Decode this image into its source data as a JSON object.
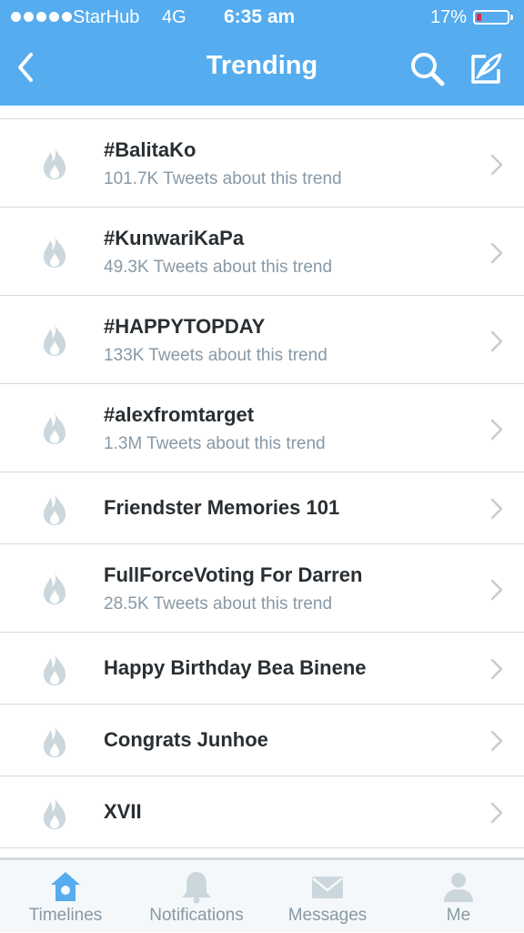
{
  "status_bar": {
    "carrier": "StarHub",
    "network": "4G",
    "time": "6:35 am",
    "battery_percent": "17%",
    "battery_level": 0.17,
    "battery_color": "#e8283a"
  },
  "nav": {
    "title": "Trending",
    "back_icon": "chevron-left-icon",
    "search_icon": "search-icon",
    "compose_icon": "compose-tweet-icon"
  },
  "trends": [
    {
      "name": "#BalitaKo",
      "subtitle": "101.7K Tweets about this trend"
    },
    {
      "name": "#KunwariKaPa",
      "subtitle": "49.3K Tweets about this trend"
    },
    {
      "name": "#HAPPYTOPDAY",
      "subtitle": "133K Tweets about this trend"
    },
    {
      "name": "#alexfromtarget",
      "subtitle": "1.3M Tweets about this trend"
    },
    {
      "name": "Friendster Memories 101",
      "subtitle": ""
    },
    {
      "name": "FullForceVoting For Darren",
      "subtitle": "28.5K Tweets about this trend"
    },
    {
      "name": "Happy Birthday Bea Binene",
      "subtitle": ""
    },
    {
      "name": "Congrats Junhoe",
      "subtitle": ""
    },
    {
      "name": "XVII",
      "subtitle": ""
    }
  ],
  "tabs": [
    {
      "label": "Timelines",
      "icon": "home-icon",
      "active": true
    },
    {
      "label": "Notifications",
      "icon": "bell-icon",
      "active": false
    },
    {
      "label": "Messages",
      "icon": "envelope-icon",
      "active": false
    },
    {
      "label": "Me",
      "icon": "person-icon",
      "active": false
    }
  ],
  "colors": {
    "accent": "#55acee",
    "text_primary": "#292f33",
    "text_secondary": "#8899a6",
    "icon_gray": "#ccd6dd",
    "divider": "#d6d9dc"
  }
}
